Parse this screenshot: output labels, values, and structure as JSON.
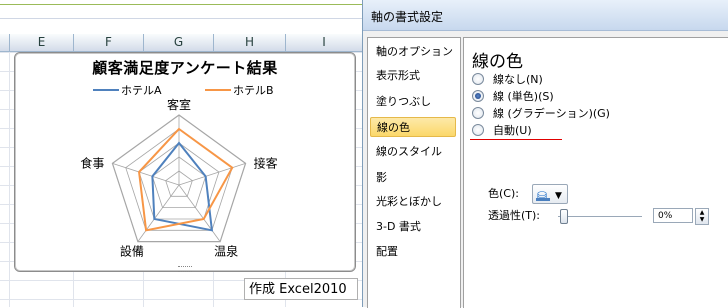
{
  "sheet": {
    "columns": [
      "E",
      "F",
      "G",
      "H",
      "I"
    ],
    "credit_text": "作成 Excel2010"
  },
  "chart_data": {
    "type": "radar",
    "title": "顧客満足度アンケート結果",
    "categories": [
      "客室",
      "接客",
      "温泉",
      "設備",
      "食事"
    ],
    "series": [
      {
        "name": "ホテルA",
        "color": "#4f81bd",
        "values": [
          3,
          2,
          4,
          3,
          2
        ]
      },
      {
        "name": "ホテルB",
        "color": "#f79646",
        "values": [
          4,
          4,
          3,
          4,
          3
        ]
      }
    ],
    "rlim": [
      0,
      5
    ],
    "gridline_color": "#a6a6a6",
    "legend_position": "top"
  },
  "dialog": {
    "title": "軸の書式設定",
    "nav_items": [
      "軸のオプション",
      "表示形式",
      "塗りつぶし",
      "線の色",
      "線のスタイル",
      "影",
      "光彩とぼかし",
      "3-D 書式",
      "配置"
    ],
    "selected_nav": "線の色",
    "heading": "線の色",
    "options": [
      "線なし(N)",
      "線 (単色)(S)",
      "線 (グラデーション)(G)",
      "自動(U)"
    ],
    "selected_option": "線 (単色)(S)",
    "color_label": "色(C):",
    "transparency_label": "透過性(T):",
    "transparency_value": "0%"
  }
}
